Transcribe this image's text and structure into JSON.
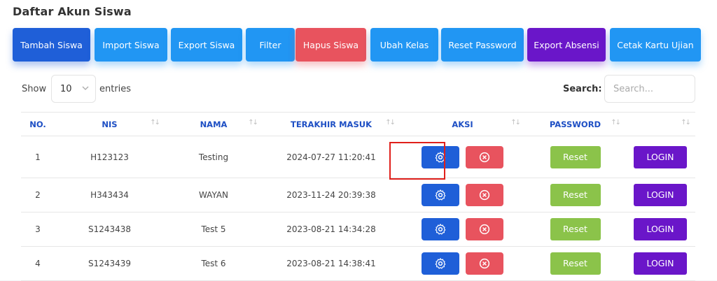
{
  "page_title": "Daftar Akun Siswa",
  "toolbar": [
    {
      "label": "Tambah Siswa",
      "color": "#1f5fd8"
    },
    {
      "label": "Import Siswa",
      "color": "#2196f3"
    },
    {
      "label": "Export Siswa",
      "color": "#2196f3"
    },
    {
      "label": "Filter",
      "color": "#2196f3"
    },
    {
      "label": "Hapus Siswa",
      "color": "#e8535e"
    },
    {
      "label": "Ubah Kelas",
      "color": "#2196f3"
    },
    {
      "label": "Reset Password",
      "color": "#2196f3"
    },
    {
      "label": "Export Absensi",
      "color": "#6a16c9"
    },
    {
      "label": "Cetak Kartu Ujian",
      "color": "#2196f3"
    }
  ],
  "length": {
    "show_label": "Show",
    "value": "10",
    "entries_label": "entries"
  },
  "search": {
    "label": "Search:",
    "placeholder": "Search..."
  },
  "table": {
    "headers": [
      "NO.",
      "NIS",
      "NAMA",
      "TERAKHIR MASUK",
      "AKSI",
      "PASSWORD",
      ""
    ],
    "reset_label": "Reset",
    "login_label": "LOGIN",
    "rows": [
      {
        "no": "1",
        "nis": "H123123",
        "nama": "Testing",
        "last_login": "2024-07-27 11:20:41"
      },
      {
        "no": "2",
        "nis": "H343434",
        "nama": "WAYAN",
        "last_login": "2023-11-24 20:39:38"
      },
      {
        "no": "3",
        "nis": "S1243438",
        "nama": "Test 5",
        "last_login": "2023-08-21 14:34:28"
      },
      {
        "no": "4",
        "nis": "S1243439",
        "nama": "Test 6",
        "last_login": "2023-08-21 14:38:41"
      }
    ]
  },
  "icons": {
    "edit": "gear-icon",
    "delete": "x-circle-icon",
    "sort": "sort-arrows-icon"
  }
}
